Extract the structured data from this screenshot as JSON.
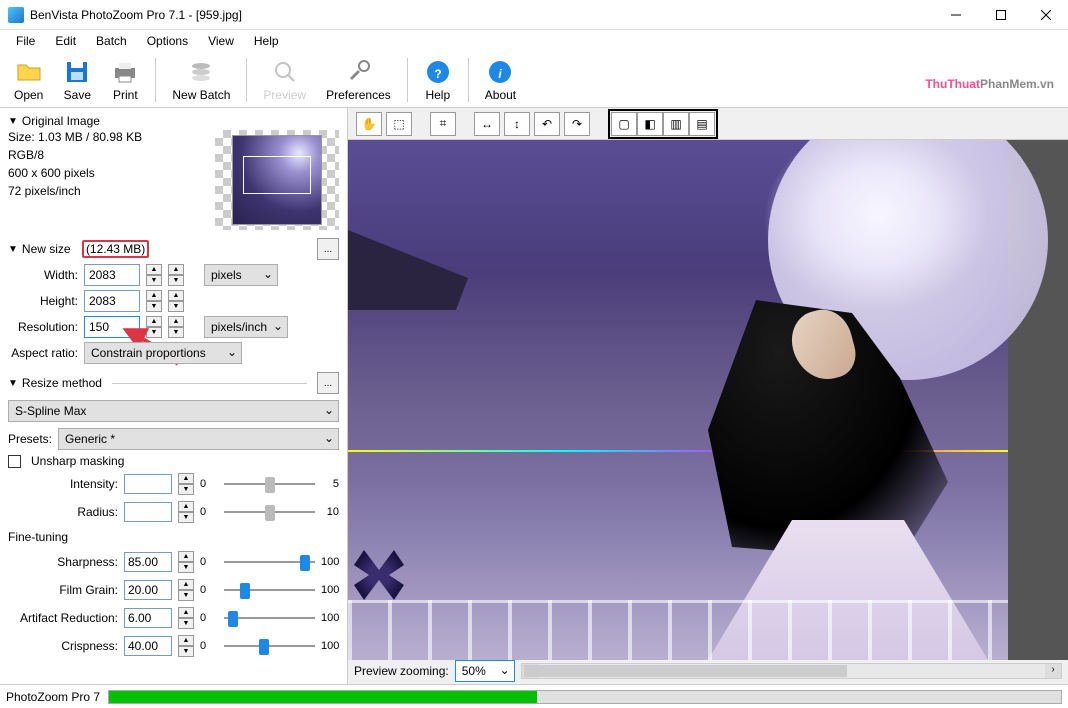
{
  "window": {
    "title": "BenVista PhotoZoom Pro 7.1 - [959.jpg]"
  },
  "menu": [
    "File",
    "Edit",
    "Batch",
    "Options",
    "View",
    "Help"
  ],
  "toolbar": [
    {
      "label": "Open",
      "icon": "open"
    },
    {
      "label": "Save",
      "icon": "save"
    },
    {
      "label": "Print",
      "icon": "print"
    },
    {
      "sep": true
    },
    {
      "label": "New Batch",
      "icon": "batch"
    },
    {
      "sep": true
    },
    {
      "label": "Preview",
      "icon": "preview",
      "disabled": true
    },
    {
      "label": "Preferences",
      "icon": "prefs"
    },
    {
      "sep": true
    },
    {
      "label": "Help",
      "icon": "help"
    },
    {
      "sep": true
    },
    {
      "label": "About",
      "icon": "about"
    }
  ],
  "watermark": {
    "bold": "ThuThuat",
    "rest": "PhanMem.vn"
  },
  "original": {
    "heading": "Original Image",
    "size": "Size: 1.03 MB / 80.98 KB",
    "mode": "RGB/8",
    "dims": "600 x 600 pixels",
    "res": "72 pixels/inch"
  },
  "newsize": {
    "heading": "New size",
    "highlight": "(12.43 MB)",
    "width_label": "Width:",
    "height_label": "Height:",
    "resolution_label": "Resolution:",
    "aspect_label": "Aspect ratio:",
    "width": "2083",
    "height": "2083",
    "resolution": "150",
    "unit": "pixels",
    "res_unit": "pixels/inch",
    "aspect": "Constrain proportions"
  },
  "resize": {
    "heading": "Resize method",
    "method": "S-Spline Max",
    "presets_label": "Presets:",
    "preset": "Generic *",
    "unsharp_label": "Unsharp masking",
    "intensity_label": "Intensity:",
    "radius_label": "Radius:",
    "intensity": "",
    "radius": "",
    "intensity_max": "5",
    "radius_max": "10",
    "finetune_label": "Fine-tuning",
    "sharpness_label": "Sharpness:",
    "filmgrain_label": "Film Grain:",
    "artifact_label": "Artifact Reduction:",
    "crispness_label": "Crispness:",
    "sharpness": "85.00",
    "filmgrain": "20.00",
    "artifact": "6.00",
    "crispness": "40.00",
    "range_min": "0",
    "range_max": "100"
  },
  "preview": {
    "label": "Preview zooming:",
    "zoom": "50%"
  },
  "statusbar": {
    "app": "PhotoZoom Pro 7"
  }
}
